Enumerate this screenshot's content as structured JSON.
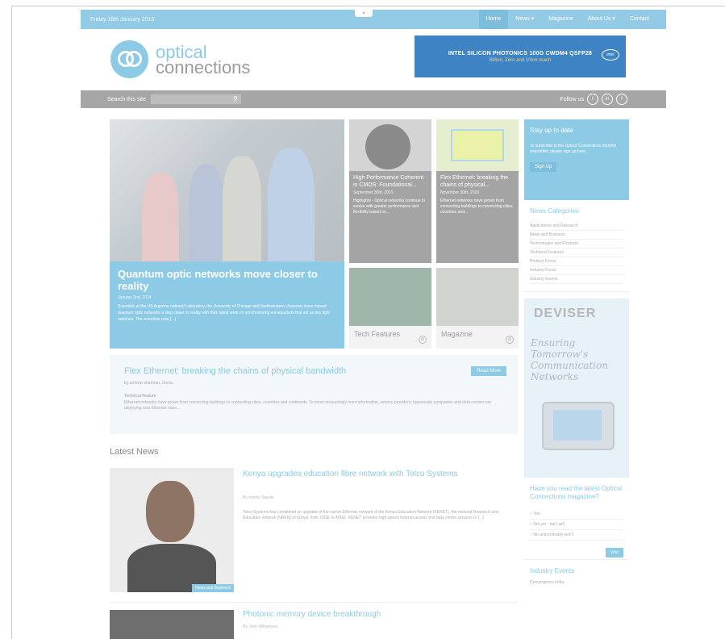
{
  "topbar": {
    "date": "Friday 16th January 2015",
    "toggle": "▲",
    "nav": [
      "Home",
      "News ▾",
      "Magazine",
      "About Us ▾",
      "Contact"
    ]
  },
  "logo": {
    "line1": "optical",
    "line2": "connections"
  },
  "ad_banner": {
    "title": "INTEL SILICON PHOTONICS 100G CWDM4 QSFP28",
    "subtitle": "Billion, Zero and 10km reach",
    "brand": "intel"
  },
  "search": {
    "label": "Search this site",
    "placeholder": "",
    "follow_label": "Follow us",
    "social": [
      "t",
      "in",
      "f"
    ]
  },
  "hero": {
    "title": "Quantum optic networks move closer to reality",
    "date": "January 2nd, 2014",
    "desc": "Scientists at the US Argonne national Laboratory, the University of Chicago and Northwestern University have moved quantum optic networks a step closer to reality with their latest work on synchronizing wavepackets that act as tiny light switches. The scientists note [...]"
  },
  "tiles": [
    {
      "title": "High Performance Coherent in CMOS: Foundational...",
      "date": "September 30th, 2015",
      "text": "Highlights - Optical networks continue to evolve with greater performance and flexibility based on..."
    },
    {
      "title": "Flex Ethernet: breaking the chains of physical...",
      "date": "November 30th, 2016",
      "text": "Ethernet networks have grown from connecting buildings to connecting cities, countries and..."
    }
  ],
  "cat_tiles": [
    {
      "label": "Tech Features",
      "icon": "⊕"
    },
    {
      "label": "Magazine",
      "icon": "⊕"
    }
  ],
  "feature": {
    "title": "Flex Ethernet: breaking the chains of physical bandwidth",
    "button": "Read More",
    "author": "by andrew sherman, Ciena",
    "category": "Technical Feature",
    "desc": "Ethernet networks have grown from connecting buildings to connecting cities, countries and continents. To move increasingly more information, service providers, hyperscale companies and data centres are deploying next Ethernet rates..."
  },
  "latest": {
    "heading": "Latest News",
    "items": [
      {
        "title": "Kenya upgrades education fibre network with Telco Systems",
        "author": "By Infinity Sandle",
        "desc": "Telco Systems has completed an upgrade of the carrier Ethernet network of the Kenya Education Network (KENET), the national Research and Education network (NREN) of Kenya, from 10GE to 40GE. KENET provides high-speed Internet access and data centre services to [...]",
        "badge": "News and Business"
      },
      {
        "title": "Photonic memory device breakthrough",
        "author": "By John Williamson",
        "desc": "",
        "badge": ""
      }
    ]
  },
  "sidebar": {
    "cta": {
      "title": "Stay up to date",
      "text": "To subscribe to the Optical Connections monthly newsletter, please sign up here.",
      "button": "Sign Up"
    },
    "categories": {
      "title": "News Categories",
      "items": [
        "Applications and Research",
        "News and Business",
        "Technologies and Products",
        "Technical Features",
        "Product Focus",
        "Industry Focus",
        "Industry Events"
      ]
    },
    "ad": {
      "logo": "DEVISER",
      "tagline": "Ensuring Tomorrow's Communication Networks"
    },
    "poll": {
      "title": "Have you read the latest Optical Connections magazine?",
      "options": [
        "Yes",
        "Not yet - but I will",
        "No and probably won't"
      ],
      "button": "Vote"
    },
    "events": {
      "title": "Industry Events",
      "items": [
        "Convergence India"
      ]
    }
  },
  "colors": {
    "accent": "#8ccae6",
    "bar": "#a6a6a6"
  }
}
